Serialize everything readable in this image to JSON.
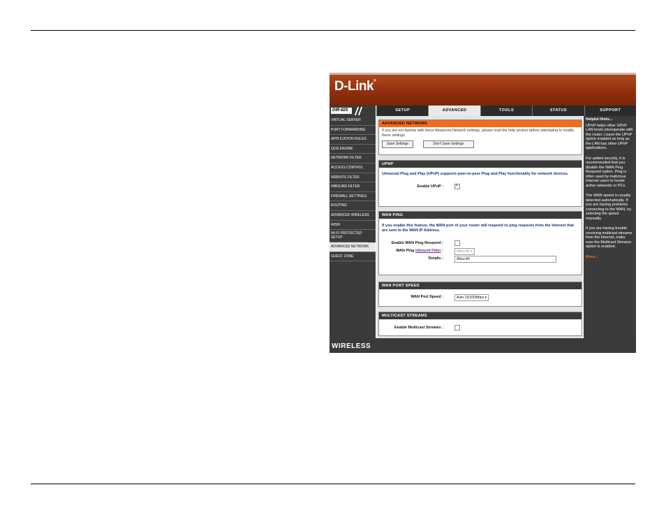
{
  "router": {
    "brand": "D-Link",
    "model": "DIR-825",
    "tabs": [
      "SETUP",
      "ADVANCED",
      "TOOLS",
      "STATUS",
      "SUPPORT"
    ],
    "active_tab": "ADVANCED",
    "sidebar": [
      "VIRTUAL SERVER",
      "PORT FORWARDING",
      "APPLICATION RULES",
      "QOS ENGINE",
      "NETWORK FILTER",
      "ACCESS CONTROL",
      "WEBSITE FILTER",
      "INBOUND FILTER",
      "FIREWALL SETTINGS",
      "ROUTING",
      "ADVANCED WIRELESS",
      "WISH",
      "WI-FI PROTECTED SETUP",
      "ADVANCED NETWORK",
      "GUEST ZONE"
    ],
    "active_sidebar": "ADVANCED NETWORK",
    "footer": "WIRELESS",
    "advanced_network": {
      "title": "ADVANCED NETWORK",
      "intro": "If you are not familiar with these Advanced Network settings, please read the help section before attempting to modify these settings.",
      "save_label": "Save Settings",
      "dont_save_label": "Don't Save Settings"
    },
    "upnp": {
      "title": "UPNP",
      "desc": "Universal Plug and Play (UPnP) supports peer-to-peer Plug and Play functionality for network devices.",
      "enable_label": "Enable UPnP :",
      "enabled": true
    },
    "wan_ping": {
      "title": "WAN PING",
      "desc": "If you enable this feature, the WAN port of your router will respond to ping requests from the Internet that are sent to the WAN IP Address.",
      "respond_label": "Enable WAN Ping Respond :",
      "respond_enabled": false,
      "filter_label_prefix": "WAN Ping",
      "filter_link": "Inbound Filter",
      "filter_label_suffix": ":",
      "filter_value": "Allow All",
      "details_label": "Details :",
      "details_value": "Allow All"
    },
    "wan_port_speed": {
      "title": "WAN PORT SPEED",
      "label": "WAN Port Speed :",
      "value": "Auto 10/100Mbps"
    },
    "multicast": {
      "title": "MULTICAST STREAMS",
      "label": "Enable Multicast Streams :",
      "enabled": false
    },
    "hints": {
      "title": "Helpful Hints...",
      "paragraphs": [
        "UPnP helps other UPnP LAN hosts interoperate with the router. Leave the UPnP option enabled as long as the LAN has other UPnP applications.",
        "For added security, it is recommended that you disable the WAN Ping Respond option. Ping is often used by malicious Internet users to locate active networks or PCs.",
        "The WAN speed is usually detected automatically. If you are having problems connecting to the WAN, try selecting the speed manually.",
        "If you are having trouble receiving multicast streams from the Internet, make sure the Multicast Streams option is enabled."
      ],
      "more": "More..."
    }
  }
}
